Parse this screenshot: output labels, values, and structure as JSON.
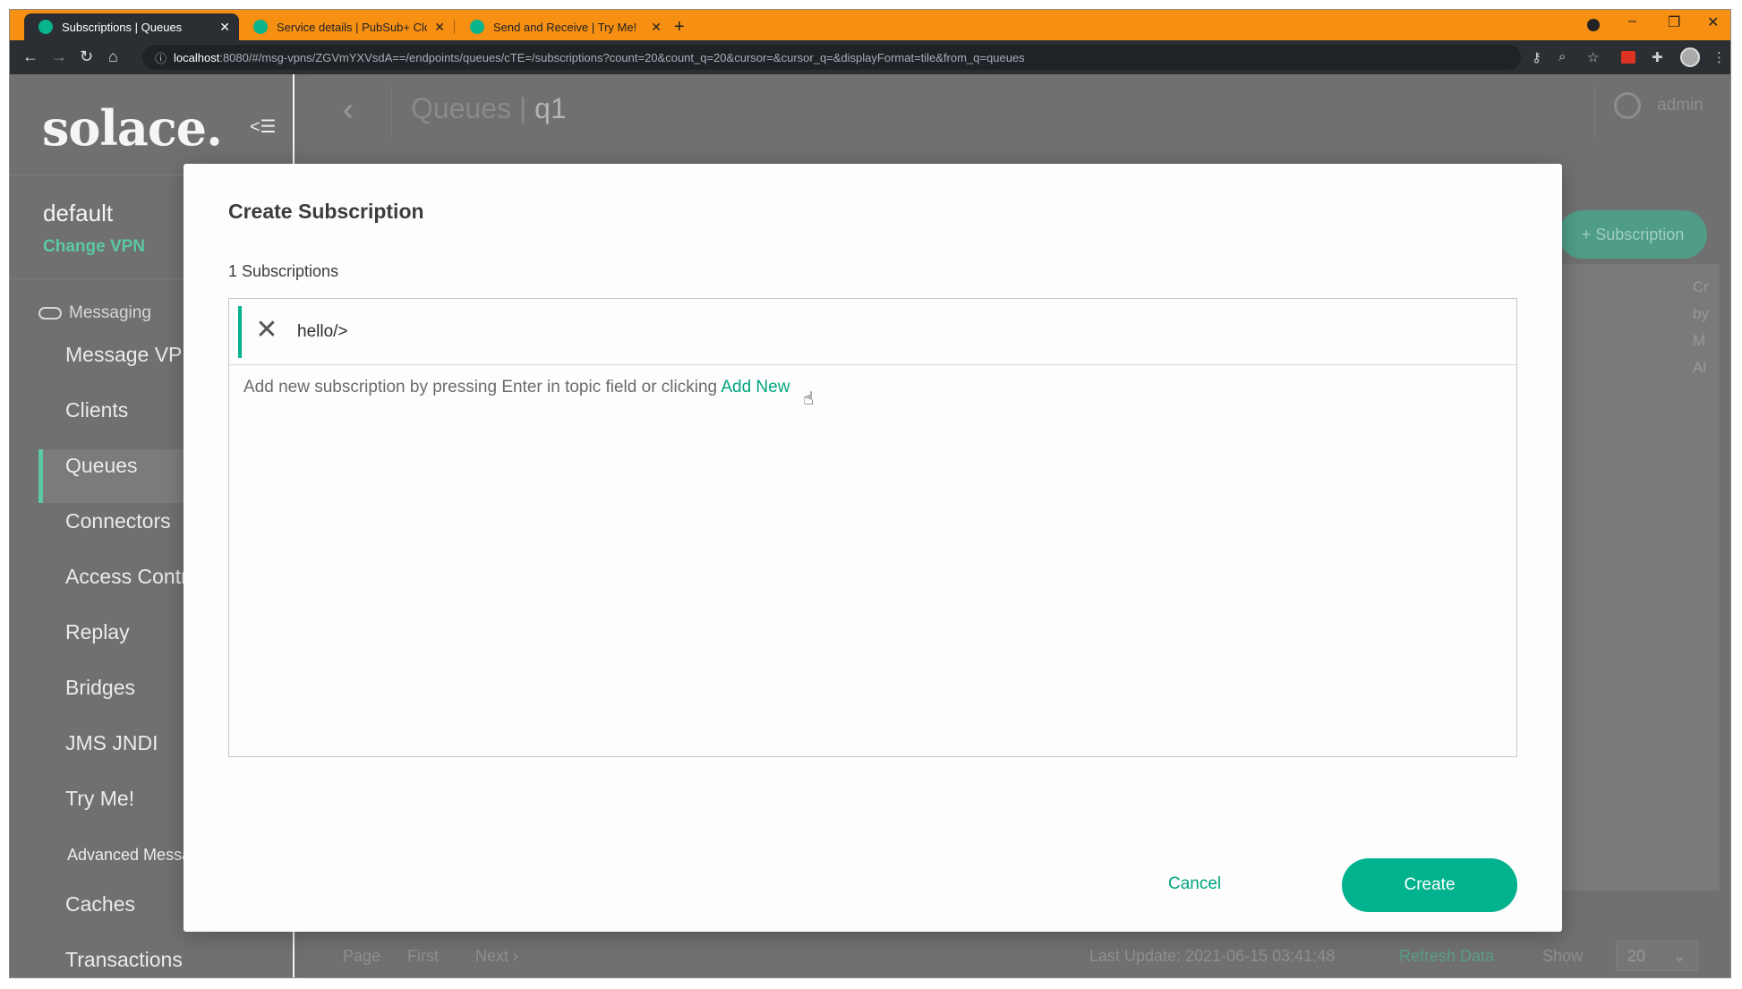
{
  "browser": {
    "tabs": [
      {
        "label": "Subscriptions | Queues",
        "active": true
      },
      {
        "label": "Service details | PubSub+ Cloud",
        "active": false
      },
      {
        "label": "Send and Receive | Try Me!",
        "active": false
      }
    ],
    "url_host": "localhost",
    "url_rest": ":8080/#/msg-vpns/ZGVmYXVsdA==/endpoints/queues/cTE=/subscriptions?count=20&count_q=20&cursor=&cursor_q=&displayFormat=tile&from_q=queues"
  },
  "sidebar": {
    "logo": "solace.",
    "vpn_name": "default",
    "change_vpn": "Change VPN",
    "section": "Messaging",
    "items": [
      {
        "label": "Message VPN"
      },
      {
        "label": "Clients"
      },
      {
        "label": "Queues"
      },
      {
        "label": "Connectors"
      },
      {
        "label": "Access Control"
      },
      {
        "label": "Replay"
      },
      {
        "label": "Bridges"
      },
      {
        "label": "JMS JNDI"
      },
      {
        "label": "Try Me!"
      },
      {
        "label": "Advanced Message"
      },
      {
        "label": "Caches"
      },
      {
        "label": "Transactions"
      }
    ]
  },
  "header": {
    "crumb_parent": "Queues",
    "crumb_current": "q1",
    "user": "admin"
  },
  "background": {
    "subscription_button": "+ Subscription",
    "cols": [
      "Cr",
      "by",
      "M",
      "Al"
    ],
    "footer": {
      "page": "Page",
      "first": "First",
      "next": "Next",
      "last_update": "Last Update: 2021-06-15 03:41:48",
      "refresh": "Refresh Data",
      "show": "Show",
      "page_size": "20"
    }
  },
  "modal": {
    "title": "Create Subscription",
    "count_label": "1 Subscriptions",
    "subscriptions": [
      {
        "topic": "hello/>"
      }
    ],
    "hint_text": "Add new subscription by pressing Enter in topic field or clicking",
    "add_new": "Add New",
    "cancel": "Cancel",
    "create": "Create"
  },
  "colors": {
    "accent": "#00b28d",
    "browser_frame": "#f68f12"
  }
}
